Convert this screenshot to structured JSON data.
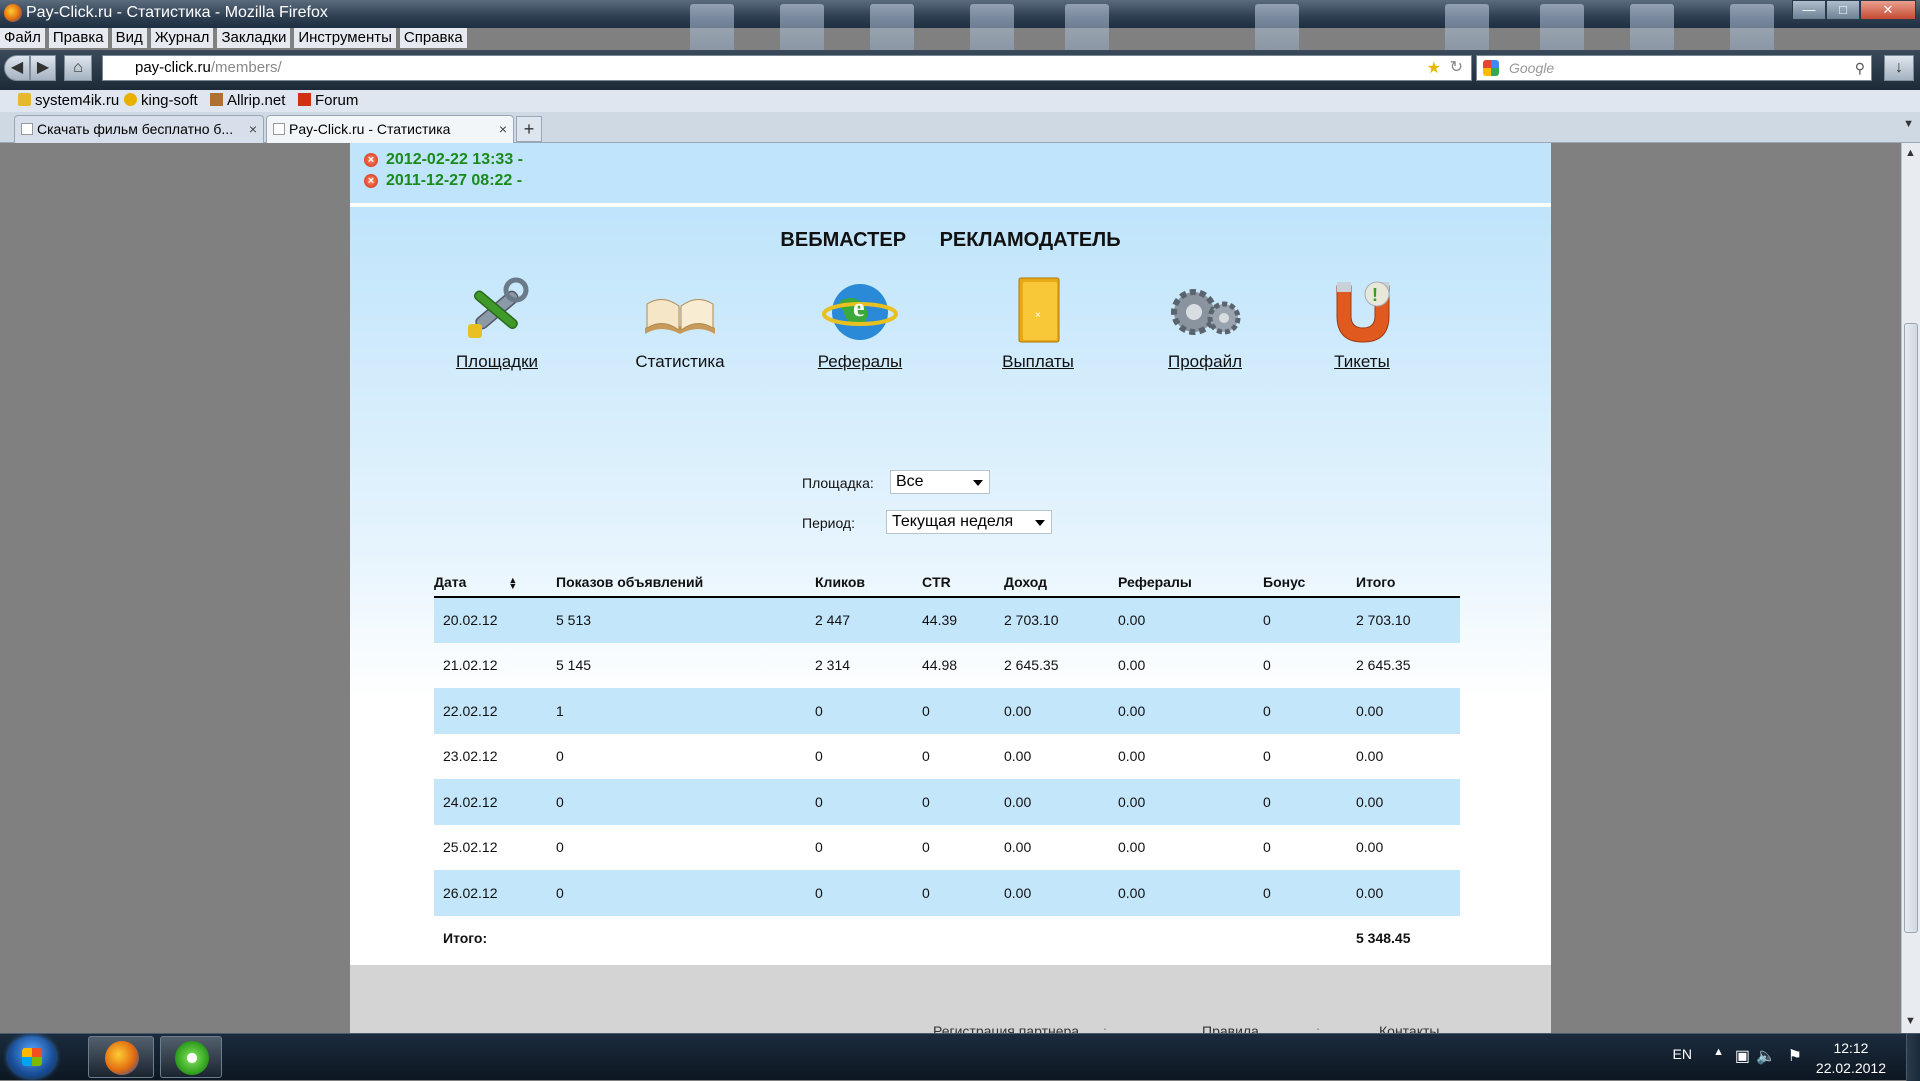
{
  "window": {
    "title": "Pay-Click.ru - Статистика - Mozilla Firefox"
  },
  "menu": [
    "Файл",
    "Правка",
    "Вид",
    "Журнал",
    "Закладки",
    "Инструменты",
    "Справка"
  ],
  "nav": {
    "url_domain": "pay-click.ru",
    "url_path": "/members/",
    "search_placeholder": "Google"
  },
  "bookmarks": [
    "system4ik.ru",
    "king-soft",
    "Allrip.net",
    "Forum"
  ],
  "tabs": [
    {
      "label": "Скачать фильм бесплатно б...",
      "active": false
    },
    {
      "label": "Pay-Click.ru - Статистика",
      "active": true
    }
  ],
  "notices": [
    "2012-02-22 13:33 -",
    "2011-12-27 08:22 -"
  ],
  "roles": [
    "ВЕБМАСТЕР",
    "РЕКЛАМОДАТЕЛЬ"
  ],
  "sections": [
    {
      "label": "Площадки",
      "icon": "tools-icon",
      "link": true
    },
    {
      "label": "Статистика",
      "icon": "book-icon",
      "link": false
    },
    {
      "label": "Рефералы",
      "icon": "globe-icon",
      "link": true
    },
    {
      "label": "Выплаты",
      "icon": "folder-icon",
      "link": true
    },
    {
      "label": "Профайл",
      "icon": "gears-icon",
      "link": true
    },
    {
      "label": "Тикеты",
      "icon": "magnet-icon",
      "link": true
    }
  ],
  "filters": {
    "site_label": "Площадка:",
    "site_value": "Все",
    "period_label": "Период:",
    "period_value": "Текущая неделя"
  },
  "table": {
    "headers": [
      "Дата",
      "Показов объявлений",
      "Кликов",
      "CTR",
      "Доход",
      "Рефералы",
      "Бонус",
      "Итого"
    ],
    "rows": [
      [
        "20.02.12",
        "5 513",
        "2 447",
        "44.39",
        "2 703.10",
        "0.00",
        "0",
        "2 703.10"
      ],
      [
        "21.02.12",
        "5 145",
        "2 314",
        "44.98",
        "2 645.35",
        "0.00",
        "0",
        "2 645.35"
      ],
      [
        "22.02.12",
        "1",
        "0",
        "0",
        "0.00",
        "0.00",
        "0",
        "0.00"
      ],
      [
        "23.02.12",
        "0",
        "0",
        "0",
        "0.00",
        "0.00",
        "0",
        "0.00"
      ],
      [
        "24.02.12",
        "0",
        "0",
        "0",
        "0.00",
        "0.00",
        "0",
        "0.00"
      ],
      [
        "25.02.12",
        "0",
        "0",
        "0",
        "0.00",
        "0.00",
        "0",
        "0.00"
      ],
      [
        "26.02.12",
        "0",
        "0",
        "0",
        "0.00",
        "0.00",
        "0",
        "0.00"
      ]
    ],
    "total_label": "Итого:",
    "total_value": "5 348.45"
  },
  "footer": [
    "Регистрация партнера",
    "Правила",
    "Контакты"
  ],
  "taskbar": {
    "lang": "EN",
    "time": "12:12",
    "date": "22.02.2012"
  }
}
